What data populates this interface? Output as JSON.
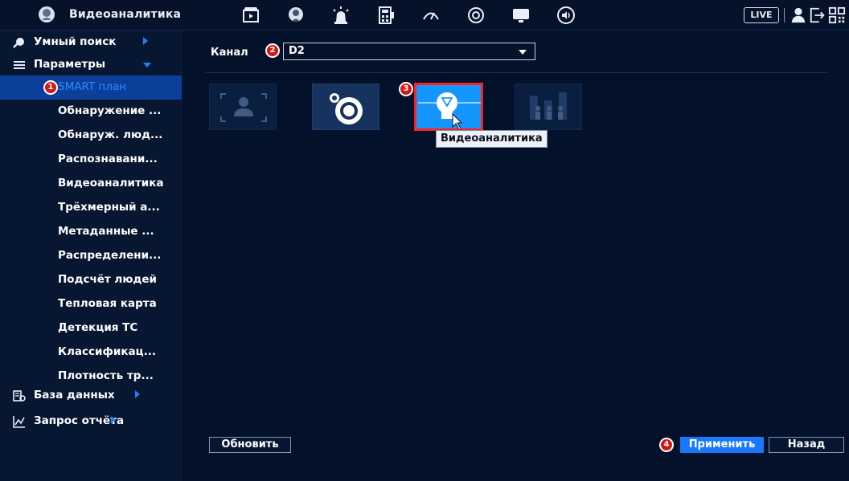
{
  "header": {
    "app_title": "Видеоаналитика",
    "live_label": "LIVE",
    "toolbar_icons": [
      "playback-icon",
      "smart-head-icon",
      "alarm-icon",
      "calculator-icon",
      "network-gauge-icon",
      "storage-disk-icon",
      "display-icon",
      "audio-icon"
    ],
    "right_icons": [
      "user-icon",
      "logout-icon",
      "qr-code-icon"
    ]
  },
  "sidebar": {
    "top_items": [
      {
        "label": "Умный поиск",
        "icon": "smart-search-icon",
        "expanded": false
      },
      {
        "label": "Параметры",
        "icon": "list-icon",
        "expanded": true
      }
    ],
    "sub_items": [
      {
        "label": "SMART план",
        "active": true
      },
      {
        "label": "Обнаружение ..."
      },
      {
        "label": "Обнаруж. люд..."
      },
      {
        "label": "Распознавани..."
      },
      {
        "label": "Видеоаналитика"
      },
      {
        "label": "Трёхмерный а..."
      },
      {
        "label": "Метаданные ..."
      },
      {
        "label": "Распределени..."
      },
      {
        "label": "Подсчёт людей"
      },
      {
        "label": "Тепловая карта"
      },
      {
        "label": "Детекция ТС"
      },
      {
        "label": "Классификац..."
      },
      {
        "label": "Плотность тр..."
      }
    ],
    "bottom_items": [
      {
        "label": "База данных",
        "icon": "database-icon",
        "expanded": false
      },
      {
        "label": "Запрос отчёта",
        "icon": "report-chart-icon",
        "expanded": false
      }
    ]
  },
  "main": {
    "channel_label": "Канал",
    "channel_value": "D2",
    "tiles": [
      {
        "name": "face-detection-plan",
        "icon": "face-frame-icon",
        "state": "disabled"
      },
      {
        "name": "fisheye-plan",
        "icon": "fisheye-lens-icon",
        "state": "normal"
      },
      {
        "name": "video-analytics-plan",
        "icon": "lightbulb-icon",
        "state": "selected"
      },
      {
        "name": "people-counting-plan",
        "icon": "people-count-icon",
        "state": "disabled"
      }
    ],
    "tooltip": "Видеоаналитика"
  },
  "footer": {
    "refresh_label": "Обновить",
    "apply_label": "Применить",
    "back_label": "Назад"
  },
  "annotations": [
    "1",
    "2",
    "3",
    "4"
  ],
  "colors": {
    "background": "#03112a",
    "sidebar": "#081731",
    "accent": "#1a78ff",
    "active_item": "#0c3f9a",
    "annotation_red": "#d41818",
    "selected_tile": "#1596ff"
  }
}
